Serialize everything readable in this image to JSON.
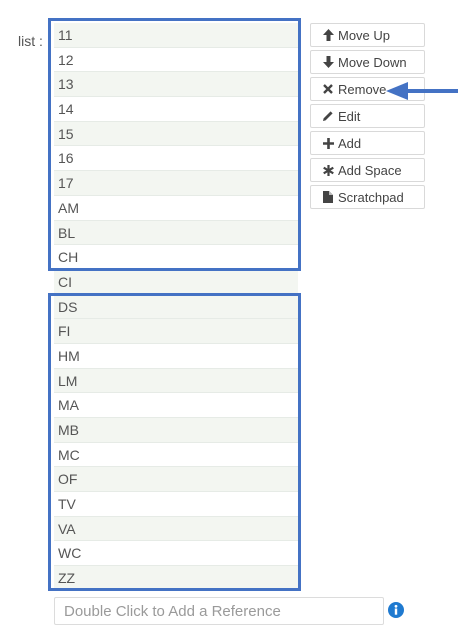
{
  "list_label": "list :",
  "items": [
    "11",
    "12",
    "13",
    "14",
    "15",
    "16",
    "17",
    "AM",
    "BL",
    "CH",
    "CI",
    "DS",
    "FI",
    "HM",
    "LM",
    "MA",
    "MB",
    "MC",
    "OF",
    "TV",
    "VA",
    "WC",
    "ZZ"
  ],
  "buttons": [
    {
      "label": "Move Up",
      "icon": "arrow-up-icon"
    },
    {
      "label": "Move Down",
      "icon": "arrow-down-icon"
    },
    {
      "label": "Remove",
      "icon": "close-icon"
    },
    {
      "label": "Edit",
      "icon": "pencil-icon"
    },
    {
      "label": "Add",
      "icon": "plus-icon"
    },
    {
      "label": "Add Space",
      "icon": "asterisk-icon"
    },
    {
      "label": "Scratchpad",
      "icon": "file-icon"
    }
  ],
  "reference_input": {
    "placeholder": "Double Click to Add a Reference",
    "value": ""
  },
  "colors": {
    "highlight_frame": "#4472c4",
    "row_alt": "#f3f6f1",
    "info_icon": "#1f7ad0"
  }
}
